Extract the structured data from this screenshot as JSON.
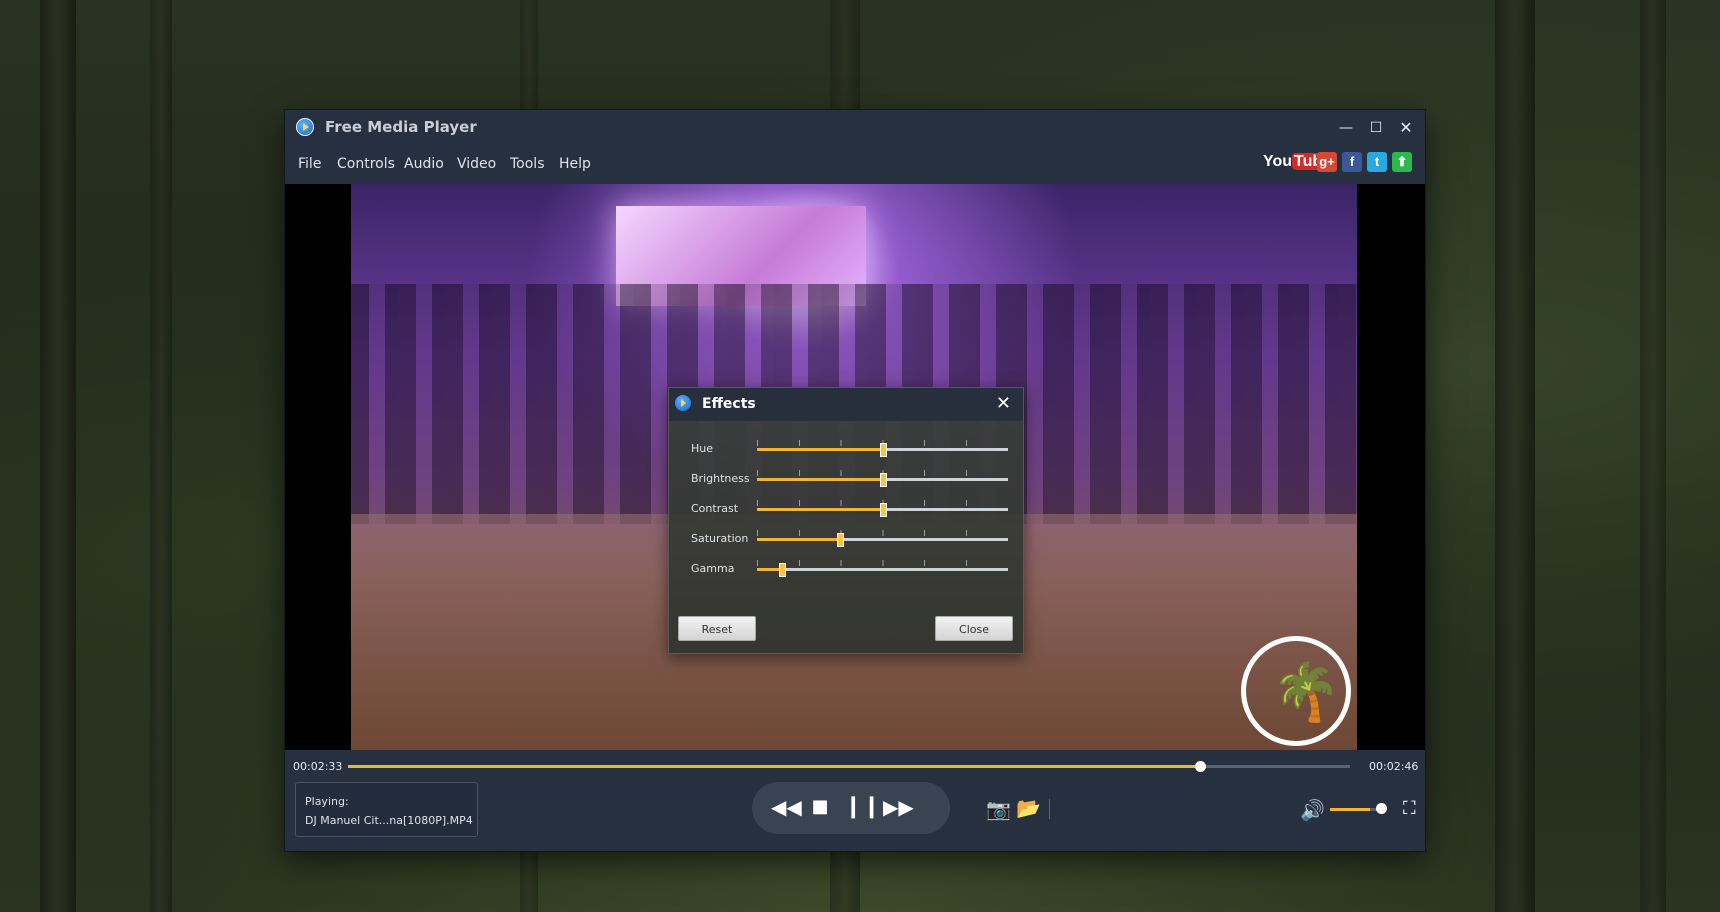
{
  "window": {
    "title": "Free Media Player",
    "controls": {
      "minimize": "—",
      "maximize": "☐",
      "close": "✕"
    }
  },
  "menu": {
    "items": [
      "File",
      "Controls",
      "Audio",
      "Video",
      "Tools",
      "Help"
    ]
  },
  "social": {
    "youtube_a": "You",
    "youtube_b": "Tube",
    "googleplus": "g+",
    "facebook": "f",
    "twitter": "t",
    "upload": "⬆",
    "colors": {
      "googleplus": "#d34836",
      "facebook": "#3b5998",
      "twitter": "#2aa9e0",
      "upload": "#2db84d"
    }
  },
  "effects": {
    "title": "Effects",
    "sliders": [
      {
        "label": "Hue",
        "value": 0.5
      },
      {
        "label": "Brightness",
        "value": 0.5
      },
      {
        "label": "Contrast",
        "value": 0.5
      },
      {
        "label": "Saturation",
        "value": 0.33
      },
      {
        "label": "Gamma",
        "value": 0.1
      }
    ],
    "reset_label": "Reset",
    "close_label": "Close"
  },
  "playback": {
    "elapsed": "00:02:33",
    "total": "00:02:46",
    "progress": 0.85,
    "now_playing_label": "Playing:",
    "file_name": "DJ Manuel Cit...na[1080P].MP4",
    "volume": 0.8
  },
  "colors": {
    "accent": "#f1b533",
    "chrome": "#26303f"
  },
  "icons": [
    "rewind-icon",
    "stop-icon",
    "pause-icon",
    "fast-forward-icon",
    "camera-icon",
    "folder-icon",
    "volume-icon",
    "fullscreen-icon"
  ]
}
